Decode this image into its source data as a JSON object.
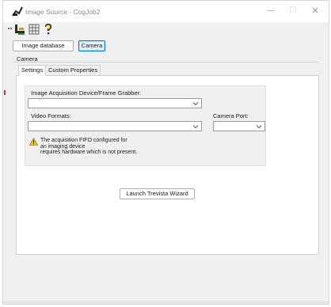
{
  "window": {
    "title": "Image Source - CogJob2",
    "minimize_glyph": "—",
    "maximize_glyph": "☐",
    "close_glyph": "✕"
  },
  "toolbar": {
    "buttons": [
      {
        "icon": "grip-icon"
      },
      {
        "icon": "acquisition-icon"
      },
      {
        "icon": "grid-icon"
      },
      {
        "icon": "help-icon"
      }
    ]
  },
  "source": {
    "image_database_label": "Image database",
    "camera_label": "Camera",
    "selected": "Camera"
  },
  "camera_group": {
    "label": "Camera"
  },
  "tabs": [
    {
      "label": "Settings",
      "active": true
    },
    {
      "label": "Custom Properties",
      "active": false
    }
  ],
  "settings": {
    "device_label": "Image Acquisition Device/Frame Grabber:",
    "device_value": "",
    "formats_label": "Video Formats:",
    "formats_value": "",
    "port_label": "Camera Port:",
    "port_value": "",
    "warning_lines": [
      "The acquisition FIFO configured for",
      "an imaging device",
      "requires hardware which is not present."
    ]
  },
  "wizard_button_label": "Launch Trevista Wizard",
  "colors": {
    "accent": "#0078d7",
    "warning": "#f2c511"
  }
}
